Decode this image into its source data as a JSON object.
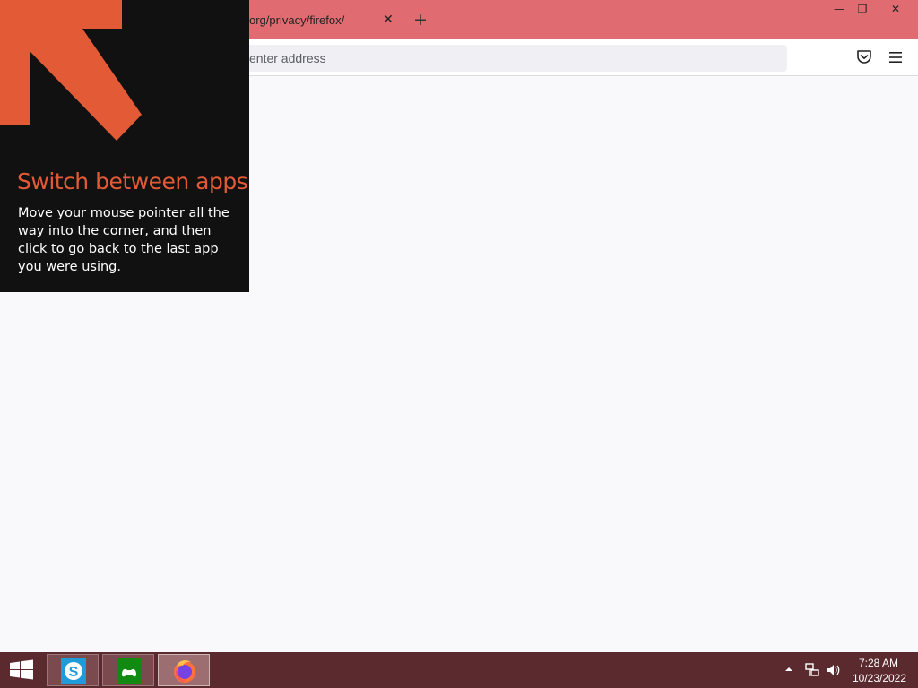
{
  "browser": {
    "tab_title": "org/privacy/firefox/",
    "tab_close": "✕",
    "new_tab": "+",
    "window_controls": {
      "minimize": "—",
      "restore": "❐",
      "close": "✕"
    },
    "url_placeholder": "enter address",
    "toolbar_icons": [
      "pocket-icon",
      "menu-icon"
    ]
  },
  "tip": {
    "title": "Switch between apps",
    "body": "Move your mouse pointer all the way into the corner, and then click to go back to the last app you were using.",
    "accent": "#e35a37"
  },
  "taskbar": {
    "apps": [
      "skype",
      "xbox-games",
      "firefox"
    ],
    "active_app": "firefox",
    "clock": {
      "time": "7:28 AM",
      "date": "10/23/2022"
    }
  },
  "colors": {
    "titlebar": "#e06b70",
    "taskbar": "#5a2a2f",
    "content_bg": "#f9f9fb"
  }
}
